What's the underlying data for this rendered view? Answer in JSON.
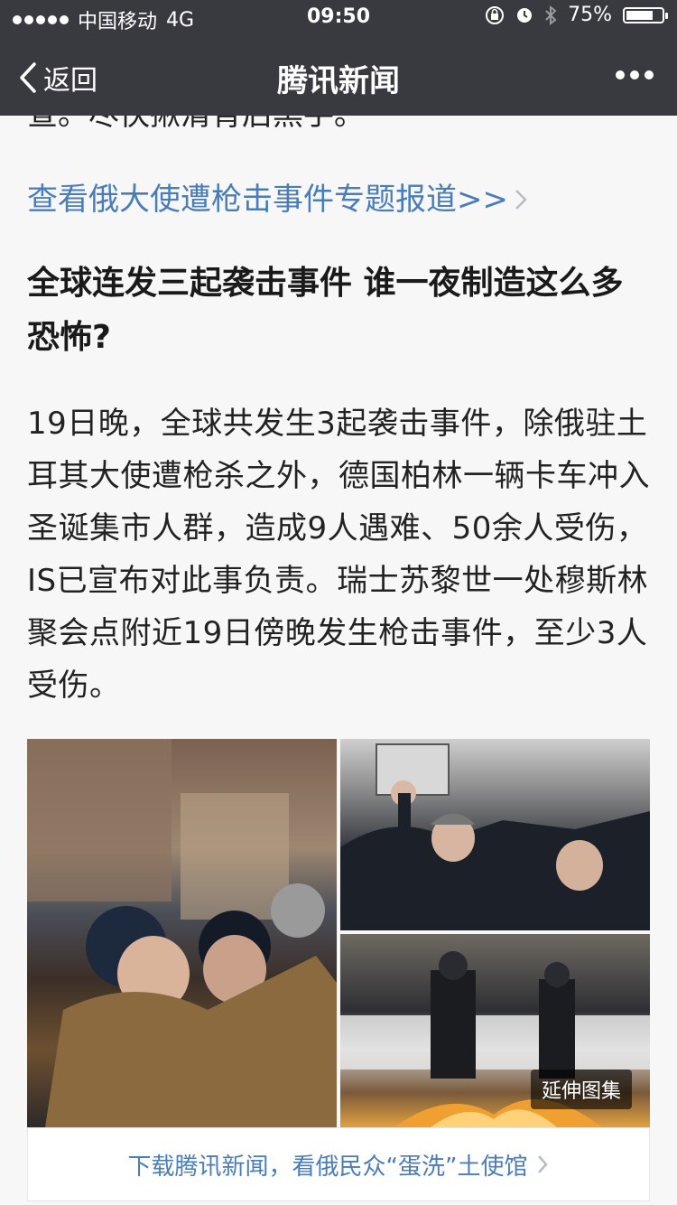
{
  "status_bar": {
    "carrier": "中国移动",
    "network": "4G",
    "time": "09:50",
    "battery_percent": "75%",
    "battery_level": 0.75
  },
  "nav": {
    "back_label": "返回",
    "title": "腾讯新闻"
  },
  "article": {
    "clipped_text": "查。尽快揪清背后黑手。",
    "topic_link": "查看俄大使遭枪击事件专题报道>>",
    "heading": "全球连发三起袭击事件 谁一夜制造这么多恐怖?",
    "body": "19日晚，全球共发生3起袭击事件，除俄驻土耳其大使遭枪杀之外，德国柏林一辆卡车冲入圣诞集市人群，造成9人遇难、50余人受伤，IS已宣布对此事负责。瑞士苏黎世一处穆斯林聚会点附近19日傍晚发生枪击事件，至少3人受伤。"
  },
  "gallery": {
    "badge": "延伸图集"
  },
  "download_bar": {
    "label": "下载腾讯新闻，看俄民众“蛋洗”土使馆"
  },
  "colors": {
    "nav_background": "#393a3f",
    "link": "#4a7db8",
    "page_background": "#f7f7f7"
  }
}
